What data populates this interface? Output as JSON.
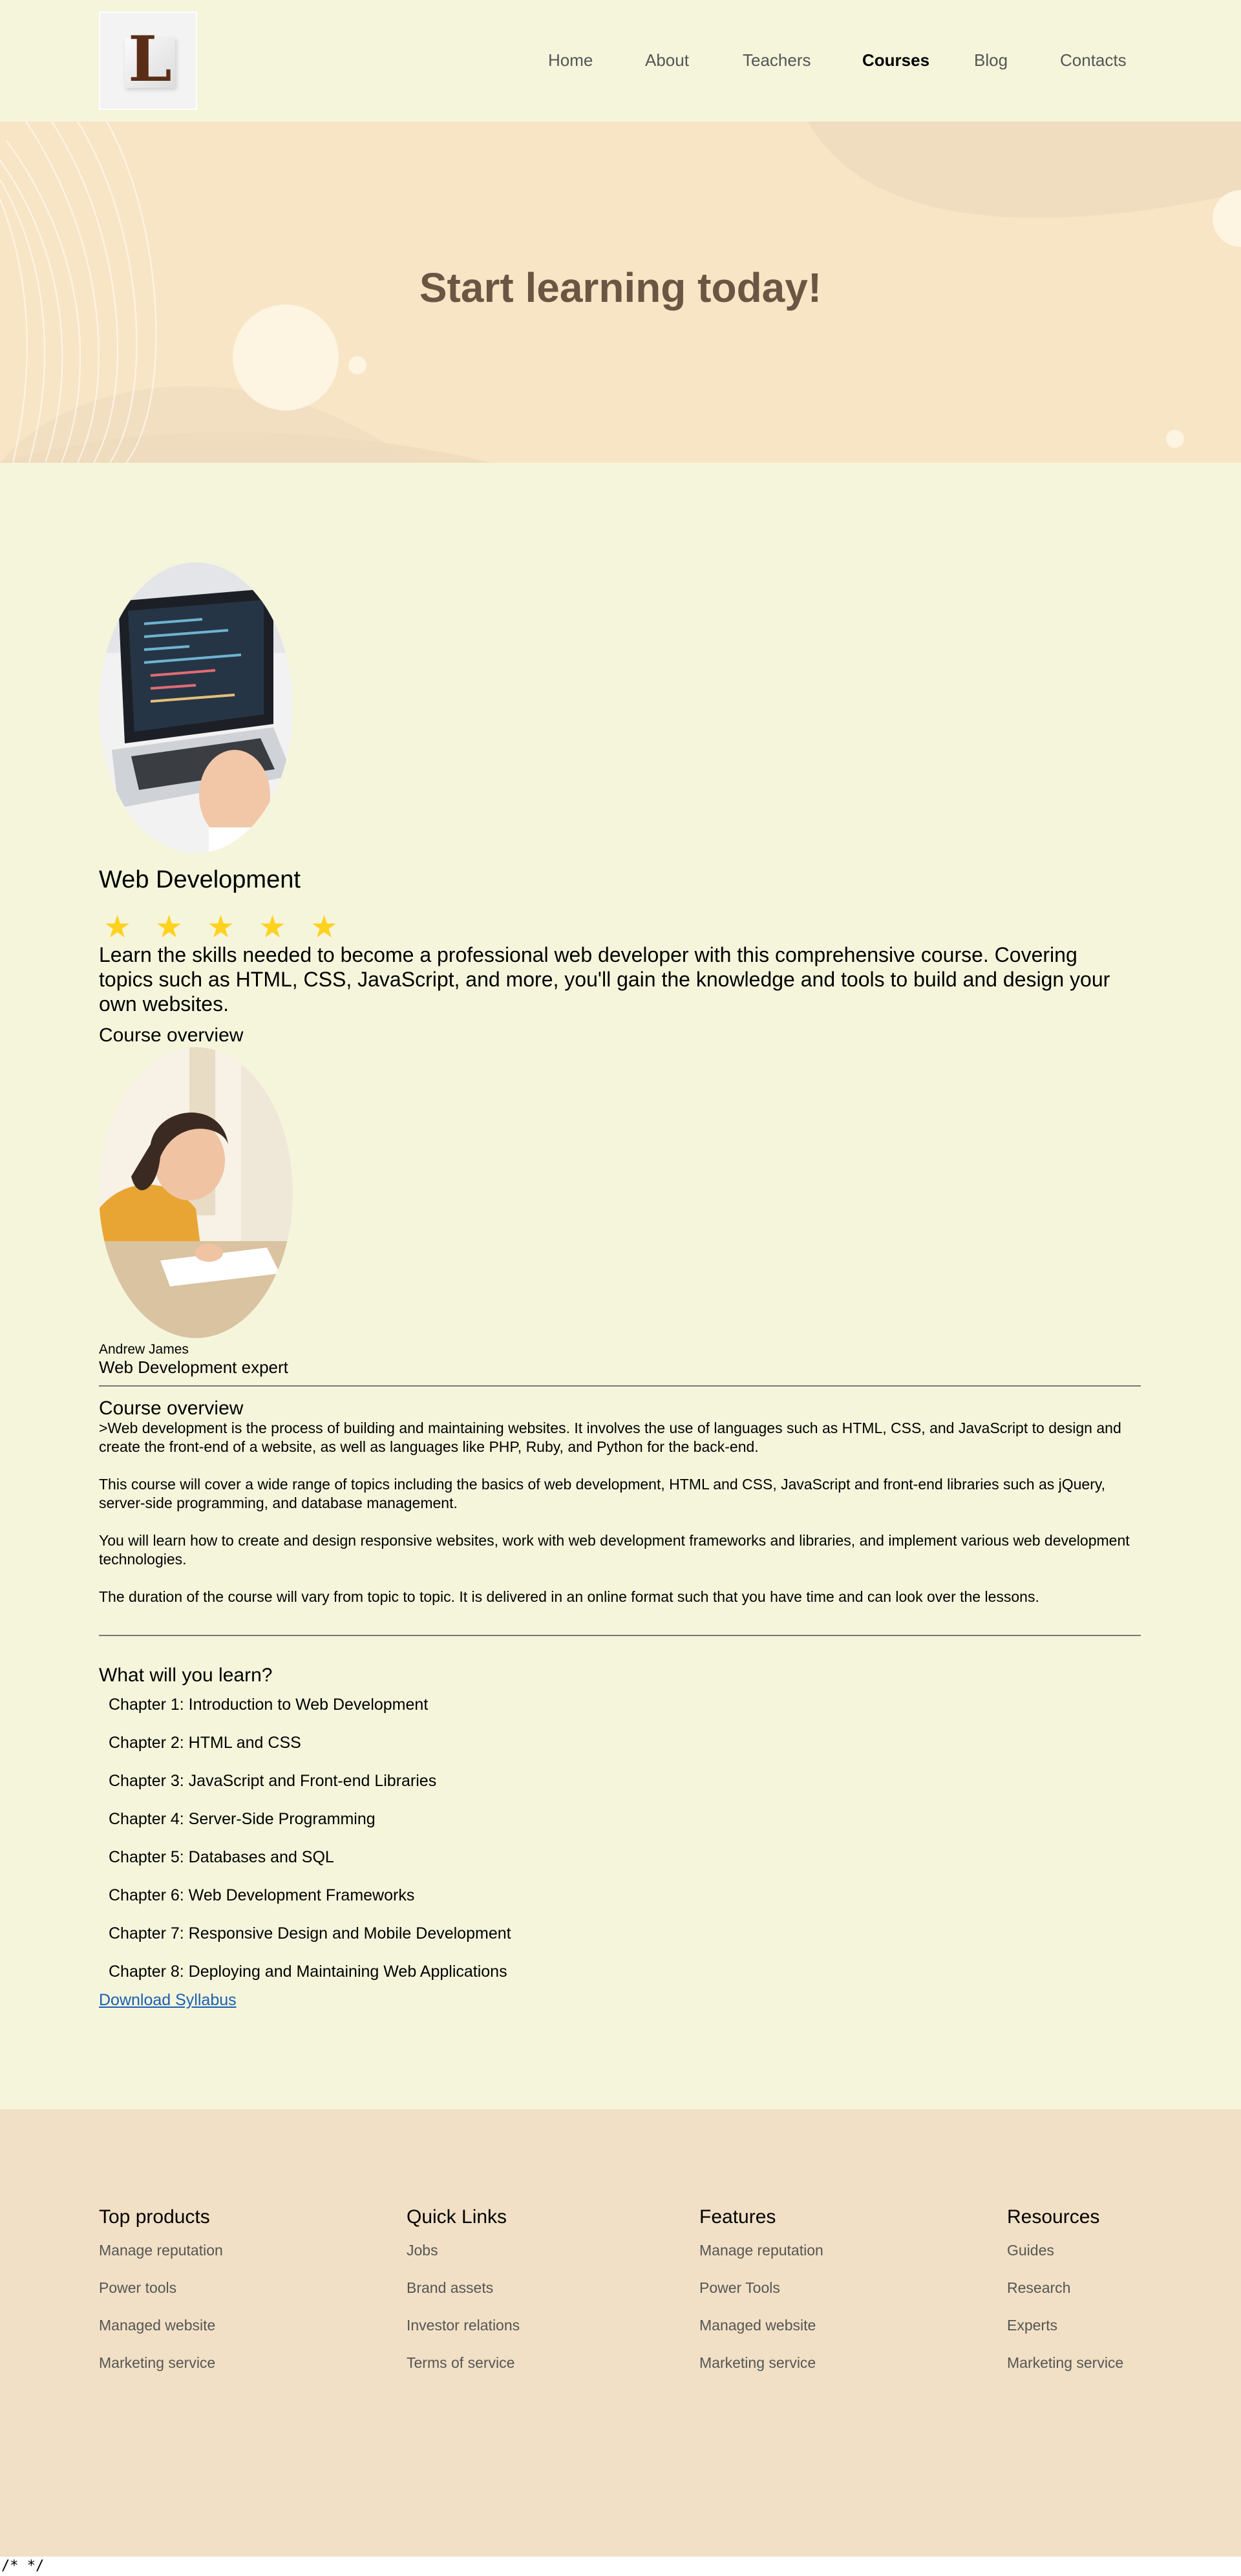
{
  "header": {
    "logo_letter": "L",
    "nav": [
      "Home",
      "About",
      "Teachers",
      "Courses",
      "Blog",
      "Contacts"
    ],
    "active": "Courses"
  },
  "hero": {
    "title": "Start learning today!"
  },
  "course": {
    "title": "Web Development",
    "rating": 5,
    "description": "Learn the skills needed to become a professional web developer with this comprehensive course. Covering topics such as HTML, CSS, JavaScript, and more, you'll gain the knowledge and tools to build and design your own websites.",
    "overview_label": "Course overview",
    "teacher_name": "Andrew James",
    "teacher_role": "Web Development expert",
    "overview_title": "Course overview",
    "paragraphs": [
      ">Web development is the process of building and maintaining websites. It involves the use of languages such as HTML, CSS, and JavaScript to design and create the front-end of a website, as well as languages like PHP, Ruby, and Python for the back-end.",
      "This course will cover a wide range of topics including the basics of web development, HTML and CSS, JavaScript and front-end libraries such as jQuery, server-side programming, and database management.",
      "You will learn how to create and design responsive websites, work with web development frameworks and libraries, and implement various web development technologies.",
      "The duration of the course will vary from topic to topic. It is delivered in an online format such that you have time and can look over the lessons."
    ],
    "learn_title": "What will you learn?",
    "chapters": [
      "Chapter 1: Introduction to Web Development",
      "Chapter 2: HTML and CSS",
      "Chapter 3: JavaScript and Front-end Libraries",
      "Chapter 4: Server-Side Programming",
      "Chapter 5: Databases and SQL",
      "Chapter 6: Web Development Frameworks",
      "Chapter 7: Responsive Design and Mobile Development",
      "Chapter 8: Deploying and Maintaining Web Applications"
    ],
    "download_label": "Download Syllabus"
  },
  "footer": {
    "columns": [
      {
        "title": "Top products",
        "links": [
          "Manage reputation",
          "Power tools",
          "Managed website",
          "Marketing service"
        ]
      },
      {
        "title": "Quick Links",
        "links": [
          "Jobs",
          "Brand assets",
          "Investor relations",
          "Terms of service"
        ]
      },
      {
        "title": "Features",
        "links": [
          "Manage reputation",
          "Power Tools",
          "Managed website",
          "Marketing service"
        ]
      },
      {
        "title": "Resources",
        "links": [
          "Guides",
          "Research",
          "Experts",
          "Marketing service"
        ]
      }
    ]
  },
  "code_note": "/* */",
  "colors": {
    "page_bg": "#f5f5dc",
    "hero_bg": "#f8e5c5",
    "hero_title": "#6b5644",
    "footer_bg": "#f1e0c5",
    "star": "#ffd21f",
    "link": "#1a5fb4"
  },
  "icons": [
    "star-icon"
  ]
}
